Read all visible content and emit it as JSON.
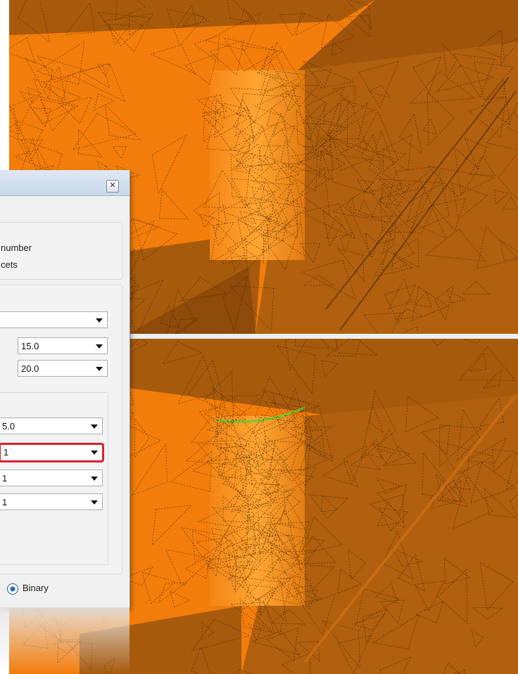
{
  "dialog": {
    "close_icon": "close-icon",
    "options": {
      "facet_number_label": "number",
      "facets_label": "cets"
    },
    "tolerance_fields": [
      {
        "value": ""
      },
      {
        "value": "15.0"
      },
      {
        "value": "20.0"
      }
    ],
    "advanced_fields": [
      {
        "value": "5.0"
      },
      {
        "value": "1"
      },
      {
        "value": "1"
      },
      {
        "value": "1"
      }
    ],
    "format": {
      "selected_label": "Binary"
    }
  },
  "viewport": {
    "mesh_color": "#f28a1a",
    "shadow_color": "#a25406",
    "highlight_field_color": "#e21d2b"
  }
}
